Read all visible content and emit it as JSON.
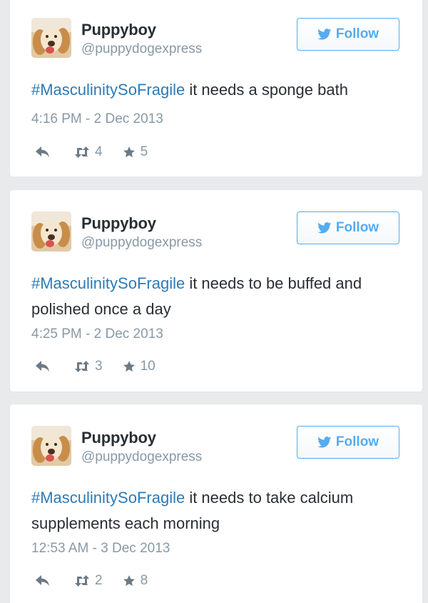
{
  "tweets": [
    {
      "author": {
        "name": "Puppyboy",
        "handle": "@puppydogexpress"
      },
      "follow_label": "Follow",
      "hashtag": "#MasculinitySoFragile",
      "text": " it needs a sponge bath",
      "timestamp": "4:16 PM - 2 Dec 2013",
      "retweets": "4",
      "favorites": "5"
    },
    {
      "author": {
        "name": "Puppyboy",
        "handle": "@puppydogexpress"
      },
      "follow_label": "Follow",
      "hashtag": "#MasculinitySoFragile",
      "text": " it needs to be buffed and polished once a day",
      "timestamp": "4:25 PM - 2 Dec 2013",
      "retweets": "3",
      "favorites": "10"
    },
    {
      "author": {
        "name": "Puppyboy",
        "handle": "@puppydogexpress"
      },
      "follow_label": "Follow",
      "hashtag": "#MasculinitySoFragile",
      "text": " it needs to take calcium supplements each morning",
      "timestamp": "12:53 AM - 3 Dec 2013",
      "retweets": "2",
      "favorites": "8"
    }
  ],
  "icons": {
    "follow": "twitter-bird-icon",
    "reply": "reply-icon",
    "retweet": "retweet-icon",
    "favorite": "star-icon"
  },
  "colors": {
    "accent": "#55acee",
    "hashtag": "#2b7bb9",
    "text": "#292f33",
    "muted": "#8899a6"
  }
}
